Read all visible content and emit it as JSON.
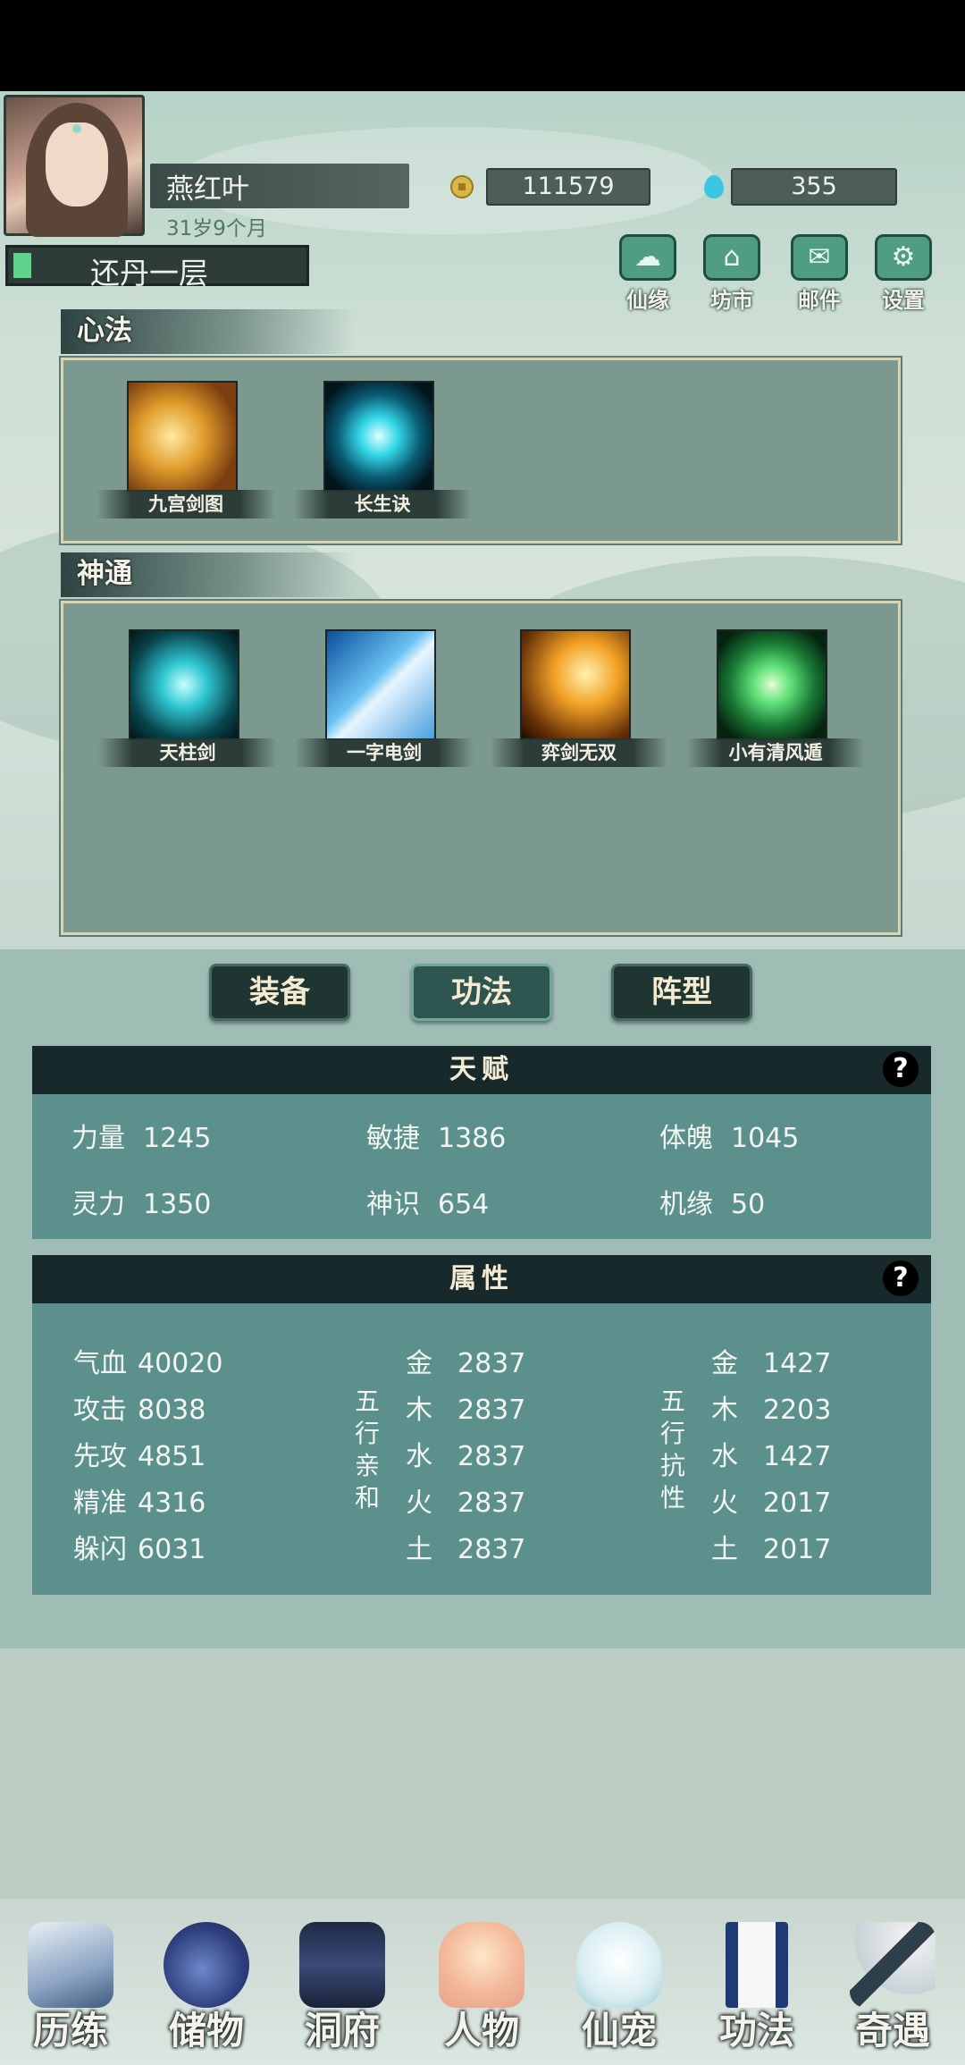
{
  "player": {
    "name": "燕红叶",
    "age": "31岁9个月",
    "realm": "还丹一层",
    "coins": "111579",
    "gems": "355"
  },
  "top_menu": [
    {
      "label": "仙缘",
      "icon": "cloud-icon"
    },
    {
      "label": "坊市",
      "icon": "market-icon"
    },
    {
      "label": "邮件",
      "icon": "mail-icon"
    },
    {
      "label": "设置",
      "icon": "gear-icon"
    }
  ],
  "xinfa": {
    "title": "心法",
    "skills": [
      {
        "name": "九宫剑图"
      },
      {
        "name": "长生诀"
      }
    ]
  },
  "shentong": {
    "title": "神通",
    "skills": [
      {
        "name": "天柱剑"
      },
      {
        "name": "一字电剑"
      },
      {
        "name": "弈剑无双"
      },
      {
        "name": "小有清风遁"
      }
    ]
  },
  "tabs": [
    {
      "label": "装备",
      "active": false
    },
    {
      "label": "功法",
      "active": true
    },
    {
      "label": "阵型",
      "active": false
    }
  ],
  "talent": {
    "title": "天赋",
    "help": "?",
    "stats": [
      {
        "k": "力量",
        "v": "1245"
      },
      {
        "k": "敏捷",
        "v": "1386"
      },
      {
        "k": "体魄",
        "v": "1045"
      },
      {
        "k": "灵力",
        "v": "1350"
      },
      {
        "k": "神识",
        "v": "654"
      },
      {
        "k": "机缘",
        "v": "50"
      }
    ]
  },
  "attributes": {
    "title": "属性",
    "help": "?",
    "basic": [
      {
        "k": "气血",
        "v": "40020"
      },
      {
        "k": "攻击",
        "v": "8038"
      },
      {
        "k": "先攻",
        "v": "4851"
      },
      {
        "k": "精准",
        "v": "4316"
      },
      {
        "k": "躲闪",
        "v": "6031"
      }
    ],
    "affinity_label": [
      "五",
      "行",
      "亲",
      "和"
    ],
    "affinity": [
      {
        "k": "金",
        "v": "2837"
      },
      {
        "k": "木",
        "v": "2837"
      },
      {
        "k": "水",
        "v": "2837"
      },
      {
        "k": "火",
        "v": "2837"
      },
      {
        "k": "土",
        "v": "2837"
      }
    ],
    "resist_label": [
      "五",
      "行",
      "抗",
      "性"
    ],
    "resist": [
      {
        "k": "金",
        "v": "1427"
      },
      {
        "k": "木",
        "v": "2203"
      },
      {
        "k": "水",
        "v": "1427"
      },
      {
        "k": "火",
        "v": "2017"
      },
      {
        "k": "土",
        "v": "2017"
      }
    ]
  },
  "bottom_nav": [
    {
      "label": "历练"
    },
    {
      "label": "储物"
    },
    {
      "label": "洞府"
    },
    {
      "label": "人物"
    },
    {
      "label": "仙宠"
    },
    {
      "label": "功法"
    },
    {
      "label": "奇遇"
    }
  ]
}
